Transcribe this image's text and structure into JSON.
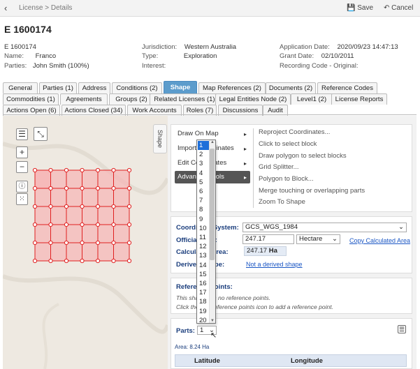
{
  "topbar": {
    "breadcrumb": "License > Details",
    "save_label": "Save",
    "cancel_label": "Cancel"
  },
  "header": {
    "title": "E 1600174"
  },
  "info": {
    "id": "E 1600174",
    "name_key": "Name:",
    "name_val": "Franco",
    "parties_key": "Parties:",
    "parties_val": "John Smith (100%)",
    "juris_key": "Jurisdiction:",
    "juris_val": "Western Australia",
    "type_key": "Type:",
    "type_val": "Exploration",
    "interest_key": "Interest:",
    "appdate_key": "Application Date:",
    "appdate_val": "2020/09/23 14:47:13",
    "grant_key": "Grant Date:",
    "grant_val": "02/10/2011",
    "recording_key": "Recording Code - Original:"
  },
  "tabs_row1": [
    "General",
    "Parties (1)",
    "Address",
    "Conditions (2)",
    "Shape",
    "Map References (2)",
    "Documents (2)",
    "Reference Codes"
  ],
  "tabs_row2": [
    "Commodities (1)",
    "Agreements",
    "Groups (2)",
    "Related Licenses (1)",
    "Legal Entities Node (2)",
    "Level1 (2)",
    "License Reports"
  ],
  "tabs_row3": [
    "Actions Open (6)",
    "Actions Closed (34)",
    "Work Accounts",
    "Roles (7)",
    "Discussions",
    "Audit"
  ],
  "active_tab": "Shape",
  "shape_side_tab": "Shape",
  "menu": {
    "items": [
      "Draw On Map",
      "Import Coordinates",
      "Edit Coordinates",
      "Advanced Tools"
    ],
    "selected": "Advanced Tools",
    "submenu": [
      "Reproject Coordinates...",
      "Click to select block",
      "Draw polygon to select blocks",
      "Grid Splitter...",
      "Polygon to Block...",
      "Merge touching or overlapping parts",
      "Zoom To Shape"
    ]
  },
  "coords": {
    "system_label": "Coordinate System:",
    "system_val": "GCS_WGS_1984",
    "official_label": "Official Area:",
    "official_val": "247.17",
    "unit_val": "Hectare",
    "copy_link": "Copy Calculated Area",
    "calc_label": "Calculated Area:",
    "calc_val": "247.17",
    "calc_unit": "Ha",
    "derived_label": "Derived Shape:",
    "derived_link": "Not a derived shape"
  },
  "refpoints": {
    "title": "Reference Points:",
    "note1": "This shape has no reference points.",
    "note2": "Click the add reference points icon to add a reference point."
  },
  "parts": {
    "label": "Parts:",
    "selected": "1",
    "area": "Area: 8.24 Ha"
  },
  "dropdown_options": [
    "1",
    "2",
    "3",
    "4",
    "5",
    "6",
    "7",
    "8",
    "9",
    "10",
    "11",
    "12",
    "13",
    "14",
    "15",
    "16",
    "17",
    "18",
    "19",
    "20"
  ],
  "table": {
    "col1": "Latitude",
    "col2": "Longitude"
  },
  "colors": {
    "accent": "#5c9ccc",
    "grid_fill": "#f5b7b7",
    "grid_stroke": "#e02020",
    "link": "#1a56c4"
  }
}
